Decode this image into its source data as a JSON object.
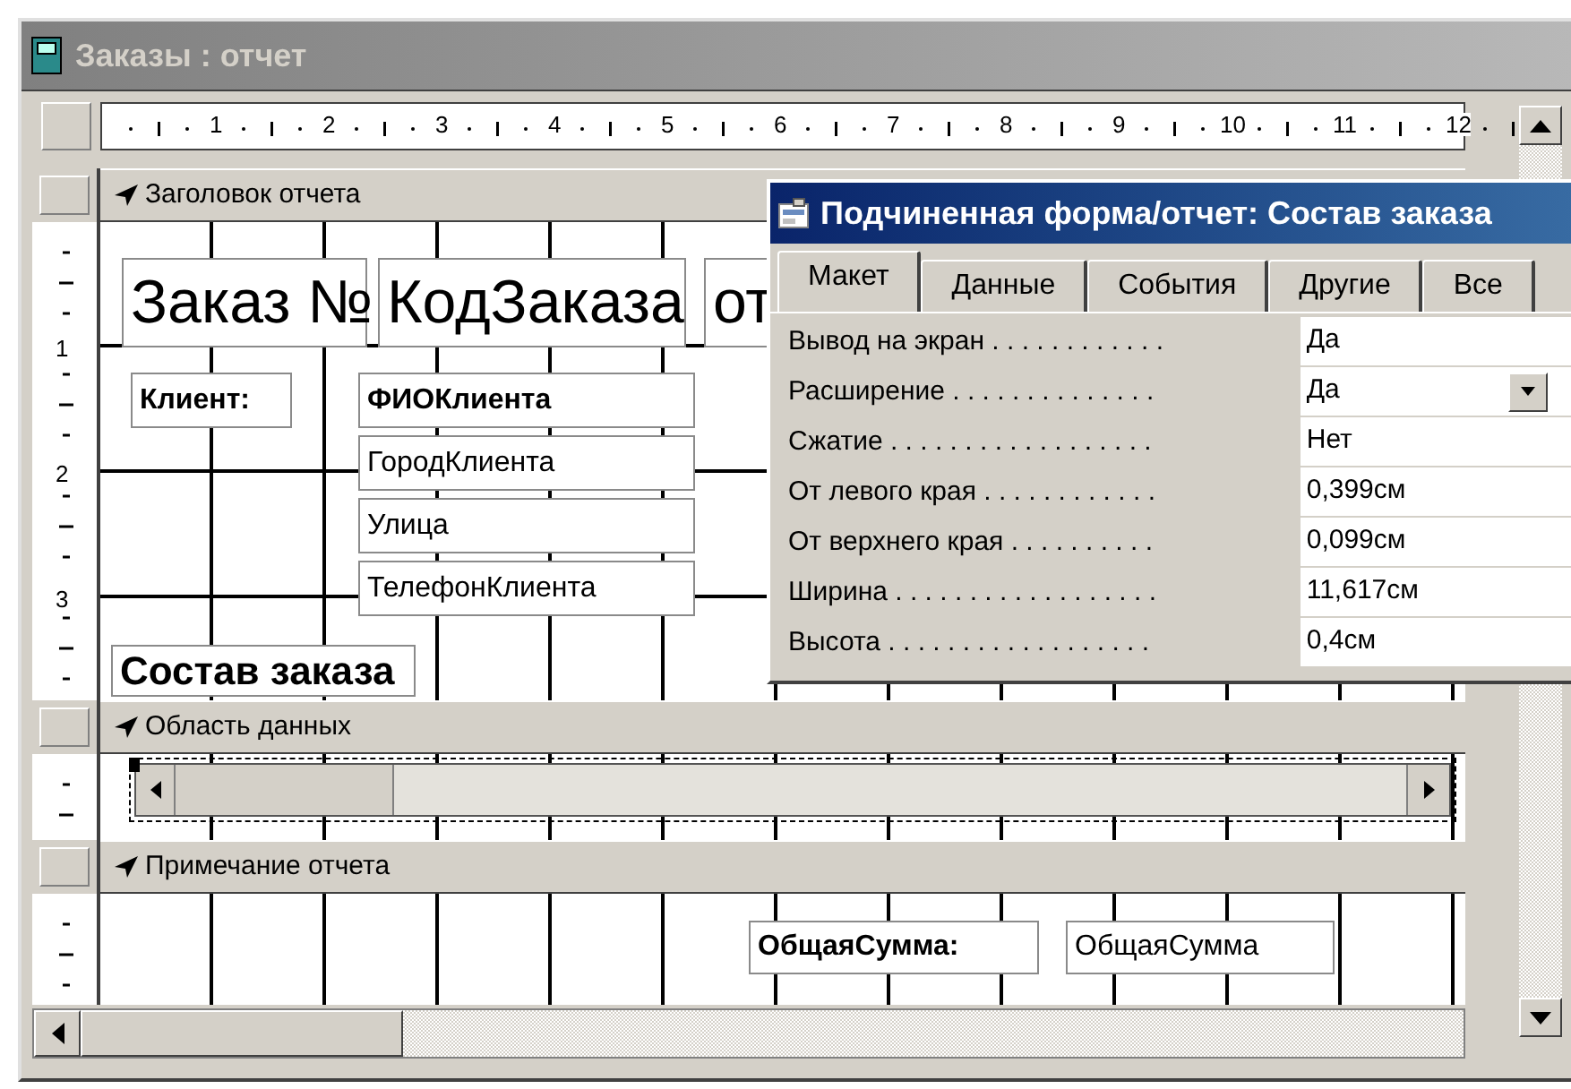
{
  "window": {
    "title": "Заказы : отчет"
  },
  "ruler": {
    "marks": [
      "1",
      "2",
      "3",
      "4",
      "5",
      "6",
      "7",
      "8",
      "9",
      "10",
      "11",
      "12"
    ]
  },
  "sections": [
    {
      "kind": "header",
      "title": "Заголовок отчета",
      "ruler_marks": [
        "1",
        "2",
        "3"
      ],
      "controls": [
        {
          "kind": "text",
          "text": "Заказ №",
          "selected": false
        },
        {
          "kind": "text",
          "text": "КодЗаказа",
          "selected": false
        },
        {
          "kind": "text",
          "text": "от",
          "selected": false
        },
        {
          "kind": "text",
          "text": "Клиент:",
          "selected": false
        },
        {
          "kind": "text",
          "text": "ФИОКлиента",
          "selected": false
        },
        {
          "kind": "text",
          "text": "ГородКлиента",
          "selected": false
        },
        {
          "kind": "text",
          "text": "Улица",
          "selected": false
        },
        {
          "kind": "text",
          "text": "ТелефонКлиента",
          "selected": false
        },
        {
          "kind": "text",
          "text": "Состав заказа",
          "selected": false
        }
      ]
    },
    {
      "kind": "detail",
      "title": "Область данных",
      "controls": [
        {
          "kind": "subform",
          "selected": true
        }
      ]
    },
    {
      "kind": "footer",
      "title": "Примечание отчета",
      "controls": [
        {
          "kind": "text",
          "text": "ОбщаяСумма:",
          "selected": false
        },
        {
          "kind": "text",
          "text": "ОбщаяСумма",
          "selected": false
        }
      ]
    }
  ],
  "property_sheet": {
    "title": "Подчиненная форма/отчет: Состав заказа",
    "tabs": [
      {
        "label": "Макет",
        "selected": true
      },
      {
        "label": "Данные",
        "selected": false
      },
      {
        "label": "События",
        "selected": false
      },
      {
        "label": "Другие",
        "selected": false
      },
      {
        "label": "Все",
        "selected": false
      }
    ],
    "properties": [
      {
        "kind": "text",
        "label": "Вывод на экран . . . . . . . . . . . .",
        "value": "Да"
      },
      {
        "kind": "dropdown",
        "label": "Расширение . . . . . . . . . . . . . .",
        "value": "Да"
      },
      {
        "kind": "text",
        "label": "Сжатие . . . . . . . . . . . . . . . . . .",
        "value": "Нет"
      },
      {
        "kind": "text",
        "label": "От левого края . . . . . . . . . . . .",
        "value": "0,399см"
      },
      {
        "kind": "text",
        "label": "От верхнего края . . . . . . . . . .",
        "value": "0,099см"
      },
      {
        "kind": "text",
        "label": "Ширина . . . . . . . . . . . . . . . . . .",
        "value": "11,617см"
      },
      {
        "kind": "text",
        "label": "Высота . . . . . . . . . . . . . . . . . .",
        "value": "0,4см"
      }
    ]
  }
}
